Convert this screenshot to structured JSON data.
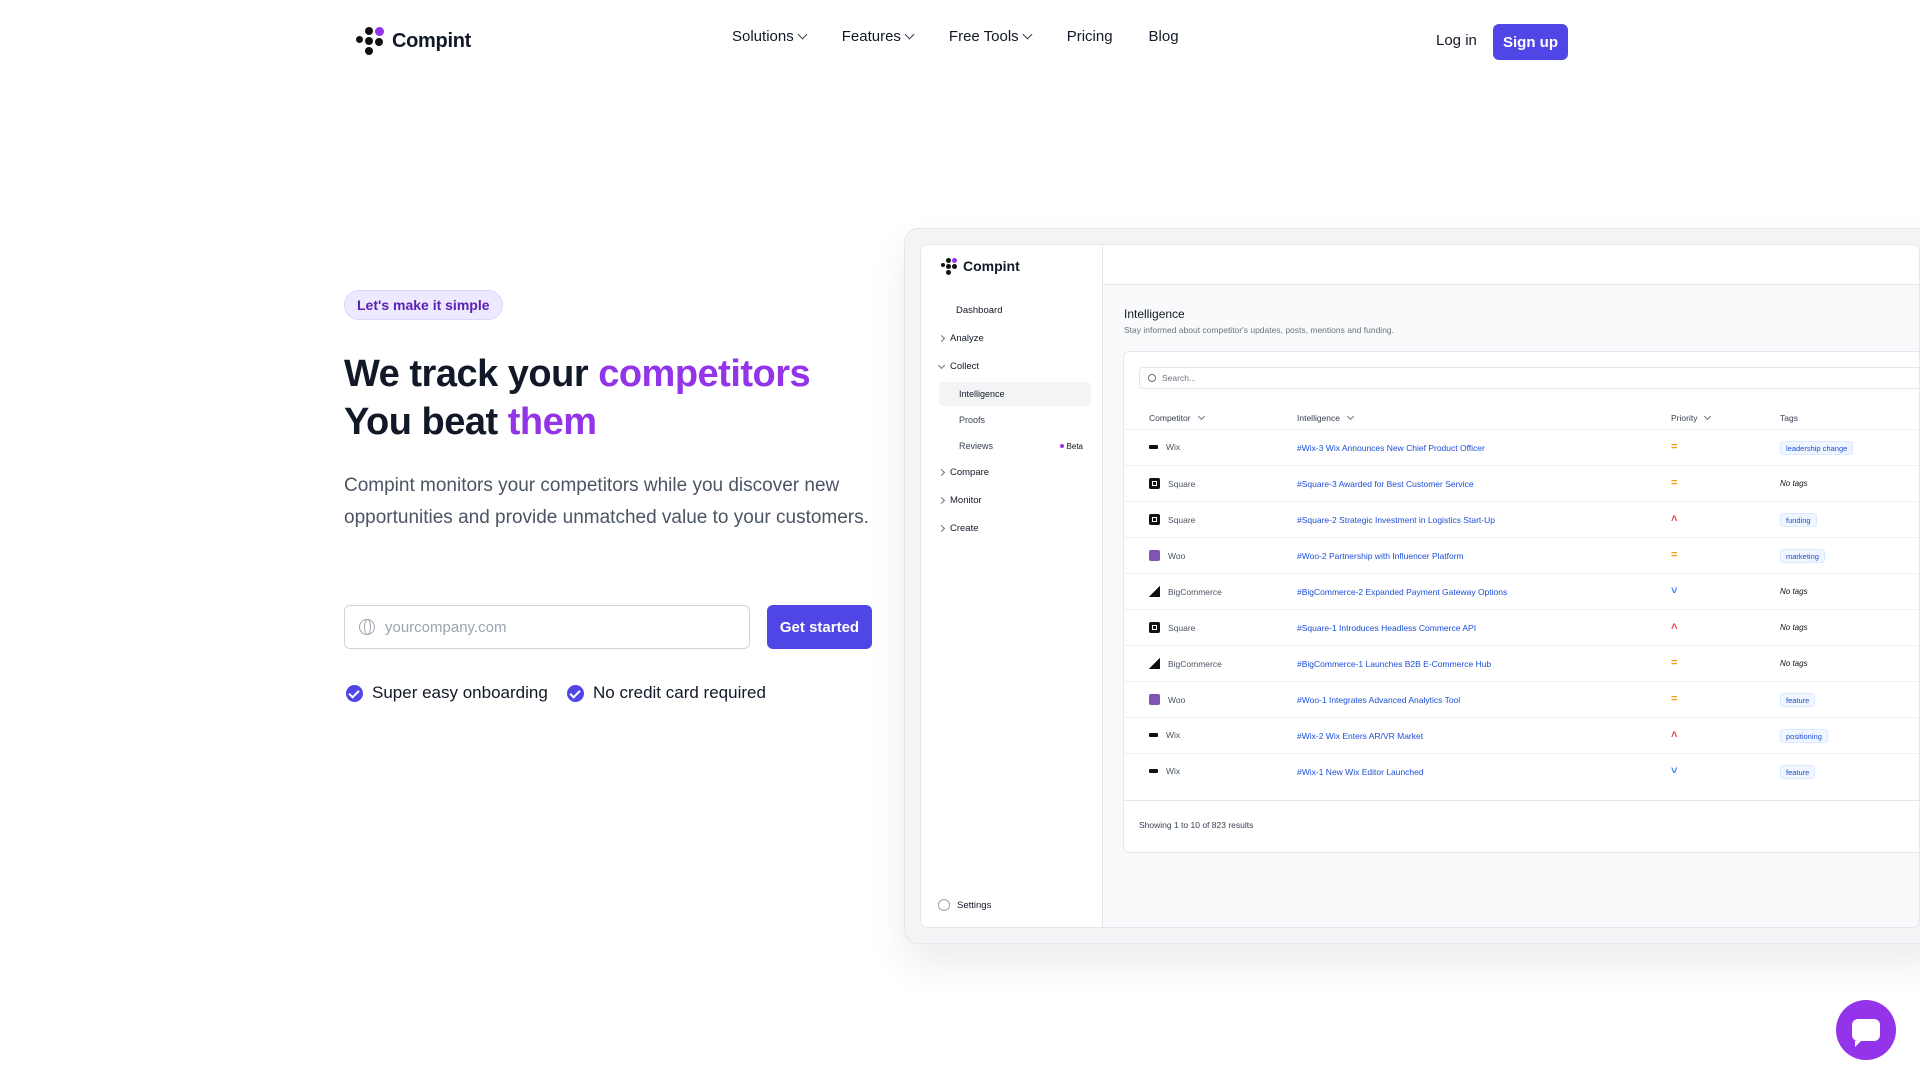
{
  "header": {
    "brand": "Compint",
    "nav": [
      {
        "label": "Solutions",
        "dropdown": true
      },
      {
        "label": "Features",
        "dropdown": true
      },
      {
        "label": "Free Tools",
        "dropdown": true
      },
      {
        "label": "Pricing",
        "dropdown": false
      },
      {
        "label": "Blog",
        "dropdown": false
      }
    ],
    "login": "Log in",
    "signup": "Sign up"
  },
  "hero": {
    "badge": "Let's make it simple",
    "line1_plain": "We track your ",
    "line1_accent": "competitors",
    "line2_plain": "You beat ",
    "line2_accent": "them",
    "lead": "Compint monitors your competitors while you discover new opportunities and provide unmatched value to your customers.",
    "input_placeholder": "yourcompany.com",
    "cta": "Get started",
    "checks": [
      "Super easy onboarding",
      "No credit card required"
    ]
  },
  "app": {
    "brand": "Compint",
    "sidebar": {
      "items": [
        {
          "label": "Dashboard",
          "arrow": "none"
        },
        {
          "label": "Analyze",
          "arrow": "right"
        },
        {
          "label": "Collect",
          "arrow": "down"
        }
      ],
      "subitems": [
        {
          "label": "Intelligence",
          "active": true,
          "beta": ""
        },
        {
          "label": "Proofs",
          "active": false,
          "beta": ""
        },
        {
          "label": "Reviews",
          "active": false,
          "beta": "Beta"
        }
      ],
      "items_after": [
        {
          "label": "Compare"
        },
        {
          "label": "Monitor"
        },
        {
          "label": "Create"
        }
      ],
      "settings": "Settings"
    },
    "page_title": "Intelligence",
    "page_subtitle": "Stay informed about competitor's updates, posts, mentions and funding.",
    "search_placeholder": "Search...",
    "columns": [
      "Competitor",
      "Intelligence",
      "Priority",
      "Tags"
    ],
    "rows": [
      {
        "competitor": "Wix",
        "icon": "wix-icon",
        "intel": "#Wix-3 Wix Announces New Chief Product Officer",
        "priority": "medium",
        "tag": "leadership change"
      },
      {
        "competitor": "Square",
        "icon": "square-icon",
        "intel": "#Square-3 Awarded for Best Customer Service",
        "priority": "medium",
        "tag": ""
      },
      {
        "competitor": "Square",
        "icon": "square-icon",
        "intel": "#Square-2 Strategic Investment in Logistics Start-Up",
        "priority": "high",
        "tag": "funding"
      },
      {
        "competitor": "Woo",
        "icon": "woo-icon",
        "intel": "#Woo-2 Partnership with Influencer Platform",
        "priority": "medium",
        "tag": "marketing"
      },
      {
        "competitor": "BigCommerce",
        "icon": "bigcommerce-icon",
        "intel": "#BigCommerce-2 Expanded Payment Gateway Options",
        "priority": "low",
        "tag": ""
      },
      {
        "competitor": "Square",
        "icon": "square-icon",
        "intel": "#Square-1 Introduces Headless Commerce API",
        "priority": "high",
        "tag": ""
      },
      {
        "competitor": "BigCommerce",
        "icon": "bigcommerce-icon",
        "intel": "#BigCommerce-1 Launches B2B E-Commerce Hub",
        "priority": "medium",
        "tag": ""
      },
      {
        "competitor": "Woo",
        "icon": "woo-icon",
        "intel": "#Woo-1 Integrates Advanced Analytics Tool",
        "priority": "medium",
        "tag": "feature"
      },
      {
        "competitor": "Wix",
        "icon": "wix-icon",
        "intel": "#Wix-2 Wix Enters AR/VR Market",
        "priority": "high",
        "tag": "positioning"
      },
      {
        "competitor": "Wix",
        "icon": "wix-icon",
        "intel": "#Wix-1 New Wix Editor Launched",
        "priority": "low",
        "tag": "feature"
      }
    ],
    "no_tags_label": "No tags",
    "results": "Showing 1 to 10 of 823 results"
  },
  "colors": {
    "primary": "#4f46e5",
    "accent": "#9333ea",
    "priority_medium": "#f59e0b",
    "priority_high": "#ef4444",
    "priority_low": "#3b82f6"
  }
}
